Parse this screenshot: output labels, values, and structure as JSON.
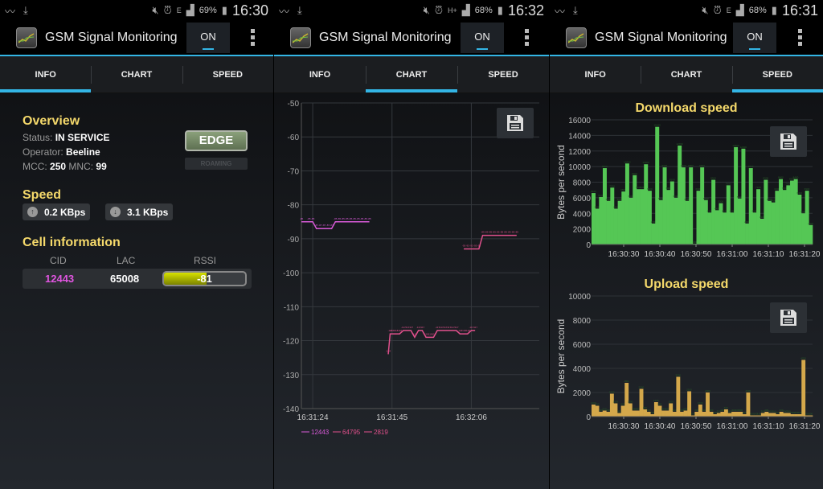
{
  "app": {
    "title": "GSM Signal Monitoring",
    "toggle_label": "ON"
  },
  "tabs": [
    "INFO",
    "CHART",
    "SPEED"
  ],
  "screens": [
    {
      "status": {
        "battery": "69%",
        "time": "16:30",
        "network": "E"
      },
      "active_tab": "INFO"
    },
    {
      "status": {
        "battery": "68%",
        "time": "16:32",
        "network": "H+"
      },
      "active_tab": "CHART"
    },
    {
      "status": {
        "battery": "68%",
        "time": "16:31",
        "network": "E"
      },
      "active_tab": "SPEED"
    }
  ],
  "info": {
    "overview_title": "Overview",
    "status_label": "Status:",
    "status_value": "IN SERVICE",
    "operator_label": "Operator:",
    "operator_value": "Beeline",
    "mcc_label": "MCC:",
    "mcc_value": "250",
    "mnc_label": "MNC:",
    "mnc_value": "99",
    "network_type": "EDGE",
    "roaming_label": "ROAMING",
    "speed_title": "Speed",
    "upload_speed": "0.2 KBps",
    "download_speed": "3.1 KBps",
    "cell_title": "Cell information",
    "cell_headers": [
      "CID",
      "LAC",
      "RSSI"
    ],
    "cell": {
      "cid": "12443",
      "lac": "65008",
      "rssi": "-81",
      "rssi_fill_fraction": 0.52
    },
    "colors": {
      "cid": "#e055e0",
      "accent": "#33b5e5",
      "title": "#f5d96b"
    }
  },
  "chart_data": [
    {
      "type": "line",
      "title": "",
      "xlabel": "",
      "ylabel": "",
      "ylim": [
        -140,
        -50
      ],
      "yticks": [
        -50,
        -60,
        -70,
        -80,
        -90,
        -100,
        -110,
        -120,
        -130,
        -140
      ],
      "xticks": [
        "16:31:24",
        "16:31:45",
        "16:32:06"
      ],
      "x_range_seconds": [
        0,
        63
      ],
      "xtick_seconds": [
        3,
        24,
        45
      ],
      "grid": true,
      "legend": "bottom-left",
      "series": [
        {
          "name": "12443",
          "color": "#d85ad8",
          "points": [
            [
              0,
              -85
            ],
            [
              2,
              -85
            ],
            [
              3,
              -85
            ],
            [
              4,
              -87
            ],
            [
              5,
              -87
            ],
            [
              6,
              -87
            ],
            [
              7,
              -87
            ],
            [
              8,
              -87
            ],
            [
              9,
              -85
            ],
            [
              10,
              -85
            ],
            [
              11,
              -85
            ],
            [
              12,
              -85
            ],
            [
              13,
              -85
            ],
            [
              14,
              -85
            ],
            [
              15,
              -85
            ],
            [
              16,
              -85
            ],
            [
              17,
              -85
            ],
            [
              18,
              -85
            ]
          ]
        },
        {
          "name": "64795",
          "color": "#e0508c",
          "points": [
            [
              23,
              -124
            ],
            [
              23.5,
              -118
            ],
            [
              24,
              -118
            ],
            [
              25,
              -118
            ],
            [
              26,
              -118
            ],
            [
              27,
              -117
            ],
            [
              28,
              -117
            ],
            [
              29,
              -117
            ],
            [
              30,
              -119
            ],
            [
              31,
              -117
            ],
            [
              32,
              -117
            ],
            [
              33,
              -119
            ],
            [
              34,
              -119
            ],
            [
              35,
              -119
            ],
            [
              36,
              -117
            ],
            [
              37,
              -117
            ],
            [
              38,
              -117
            ],
            [
              39,
              -117
            ],
            [
              40,
              -117
            ],
            [
              41,
              -117
            ],
            [
              42,
              -118
            ],
            [
              43,
              -118
            ],
            [
              44,
              -118
            ],
            [
              45,
              -117
            ],
            [
              46,
              -117
            ]
          ]
        },
        {
          "name": "2819",
          "color": "#e0508c",
          "points": [
            [
              43,
              -93
            ],
            [
              44,
              -93
            ],
            [
              45,
              -93
            ],
            [
              46,
              -93
            ],
            [
              47,
              -93
            ],
            [
              48,
              -89
            ],
            [
              49,
              -89
            ],
            [
              50,
              -89
            ],
            [
              51,
              -89
            ],
            [
              52,
              -89
            ],
            [
              53,
              -89
            ],
            [
              54,
              -89
            ],
            [
              55,
              -89
            ],
            [
              56,
              -89
            ],
            [
              57,
              -89
            ]
          ]
        }
      ]
    },
    {
      "type": "bar",
      "title": "Download speed",
      "xlabel": "",
      "ylabel": "Bytes per second",
      "ylim": [
        0,
        16000
      ],
      "yticks": [
        0,
        2000,
        4000,
        6000,
        8000,
        10000,
        12000,
        14000,
        16000
      ],
      "xticks": [
        "16:30:30",
        "16:30:40",
        "16:30:50",
        "16:31:00",
        "16:31:10",
        "16:31:20"
      ],
      "color": "#55c755",
      "values": [
        6600,
        4600,
        6100,
        9800,
        5600,
        7300,
        4600,
        5600,
        6800,
        10400,
        6000,
        8900,
        7100,
        7100,
        10300,
        6900,
        2700,
        15100,
        5700,
        9900,
        7000,
        8100,
        6000,
        12700,
        9900,
        5600,
        9900,
        100,
        6900,
        9900,
        5700,
        4100,
        8300,
        4400,
        5300,
        4100,
        7600,
        4100,
        12500,
        5900,
        12300,
        2700,
        9800,
        4100,
        7100,
        3300,
        8300,
        5600,
        5400,
        6900,
        8400,
        7000,
        7600,
        8200,
        8400,
        6400,
        4000,
        6900,
        2500
      ],
      "grid": true
    },
    {
      "type": "bar",
      "title": "Upload speed",
      "xlabel": "",
      "ylabel": "Bytes per second",
      "ylim": [
        0,
        10000
      ],
      "yticks": [
        0,
        2000,
        4000,
        6000,
        8000,
        10000
      ],
      "xticks": [
        "16:30:30",
        "16:30:40",
        "16:30:50",
        "16:31:00",
        "16:31:10",
        "16:31:20"
      ],
      "color": "#d4a84b",
      "values": [
        1000,
        900,
        400,
        500,
        400,
        1900,
        1100,
        300,
        900,
        2800,
        1100,
        500,
        500,
        2300,
        600,
        400,
        200,
        1200,
        900,
        500,
        500,
        1100,
        400,
        3300,
        400,
        500,
        2100,
        100,
        400,
        1000,
        400,
        2000,
        400,
        200,
        300,
        400,
        600,
        300,
        400,
        400,
        400,
        200,
        2000,
        100,
        100,
        100,
        300,
        400,
        300,
        300,
        200,
        400,
        300,
        300,
        200,
        200,
        200,
        4700,
        100,
        100
      ],
      "grid": true
    }
  ]
}
